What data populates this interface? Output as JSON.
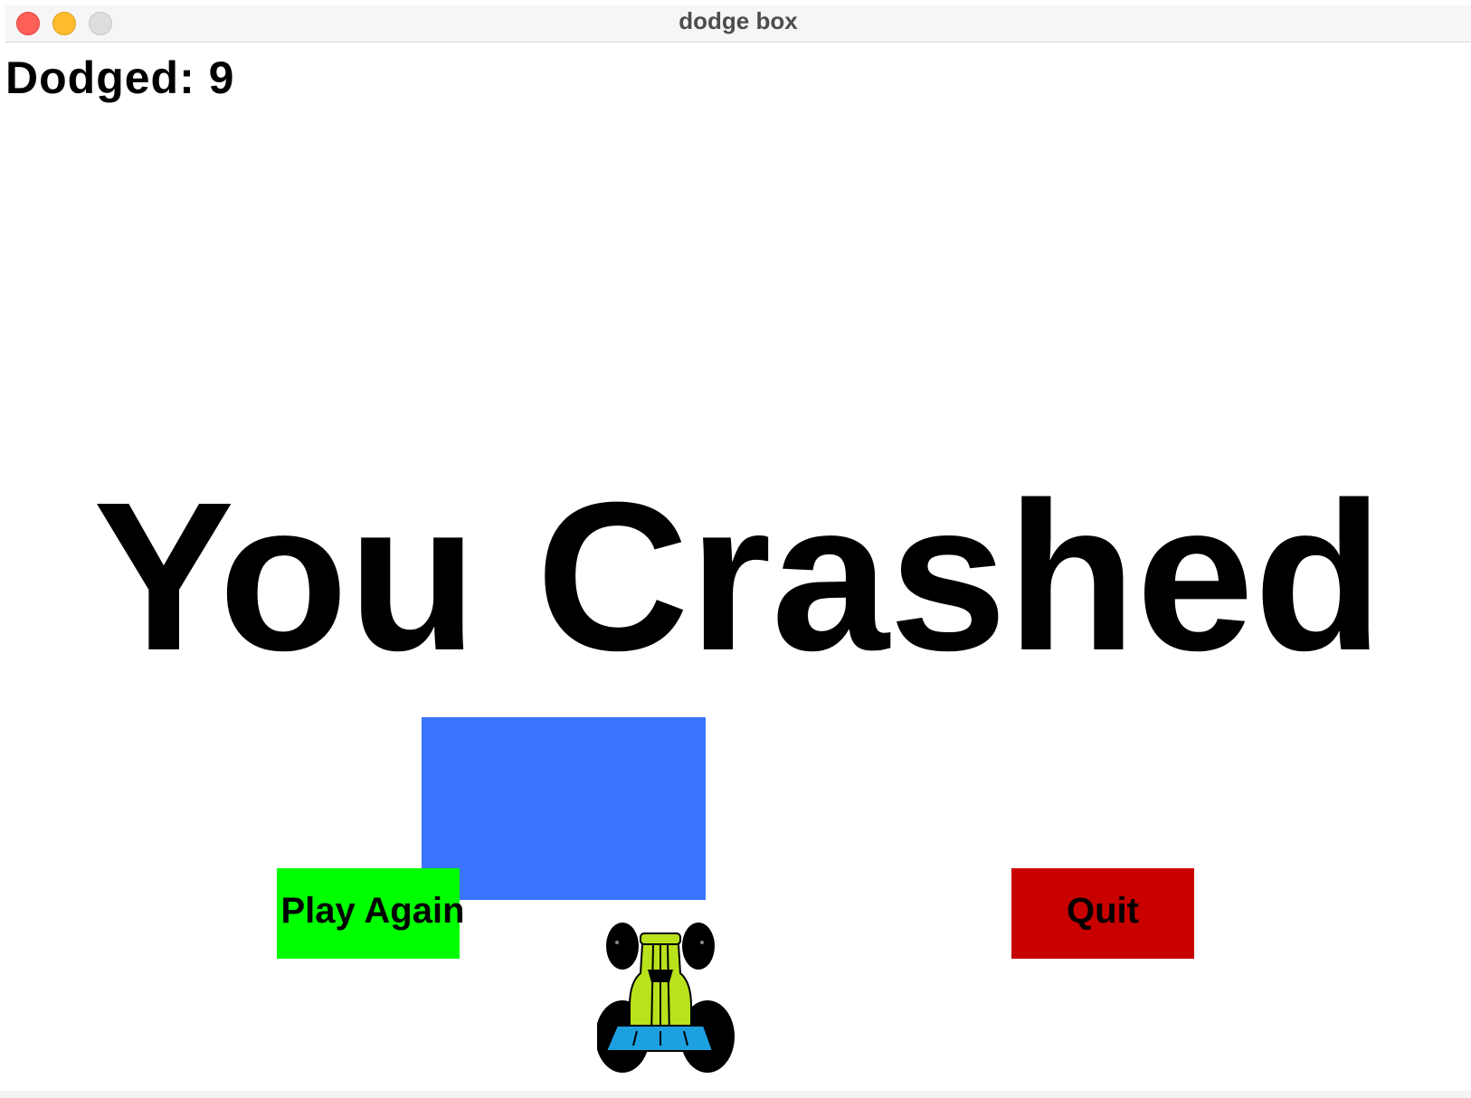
{
  "window": {
    "title": "dodge box"
  },
  "game": {
    "score_label": "Dodged: 9",
    "dodged_count": 9,
    "crash_message": "You Crashed",
    "buttons": {
      "play_again": "Play Again",
      "quit": "Quit"
    },
    "colors": {
      "obstacle": "#3a74ff",
      "play_again_button": "#00ff00",
      "quit_button": "#c80000",
      "text": "#000000",
      "car_body": "#b8e21c",
      "car_seat": "#1ca0e0"
    }
  }
}
